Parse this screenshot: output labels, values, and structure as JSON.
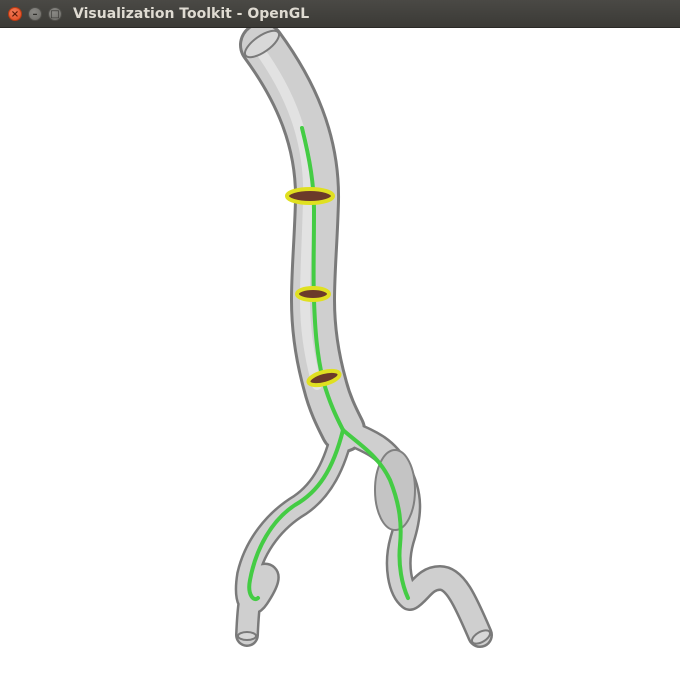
{
  "window": {
    "title": "Visualization Toolkit - OpenGL",
    "close_glyph": "×",
    "minimize_glyph": "–",
    "maximize_glyph": "□"
  },
  "scene": {
    "background_color": "#ffffff",
    "vessel_color": "#c8c8c8",
    "centerline_color": "#44cc44",
    "ring_color": "#e0e020",
    "ring_fill_color": "#6b3a2a",
    "rings_count": 3
  }
}
